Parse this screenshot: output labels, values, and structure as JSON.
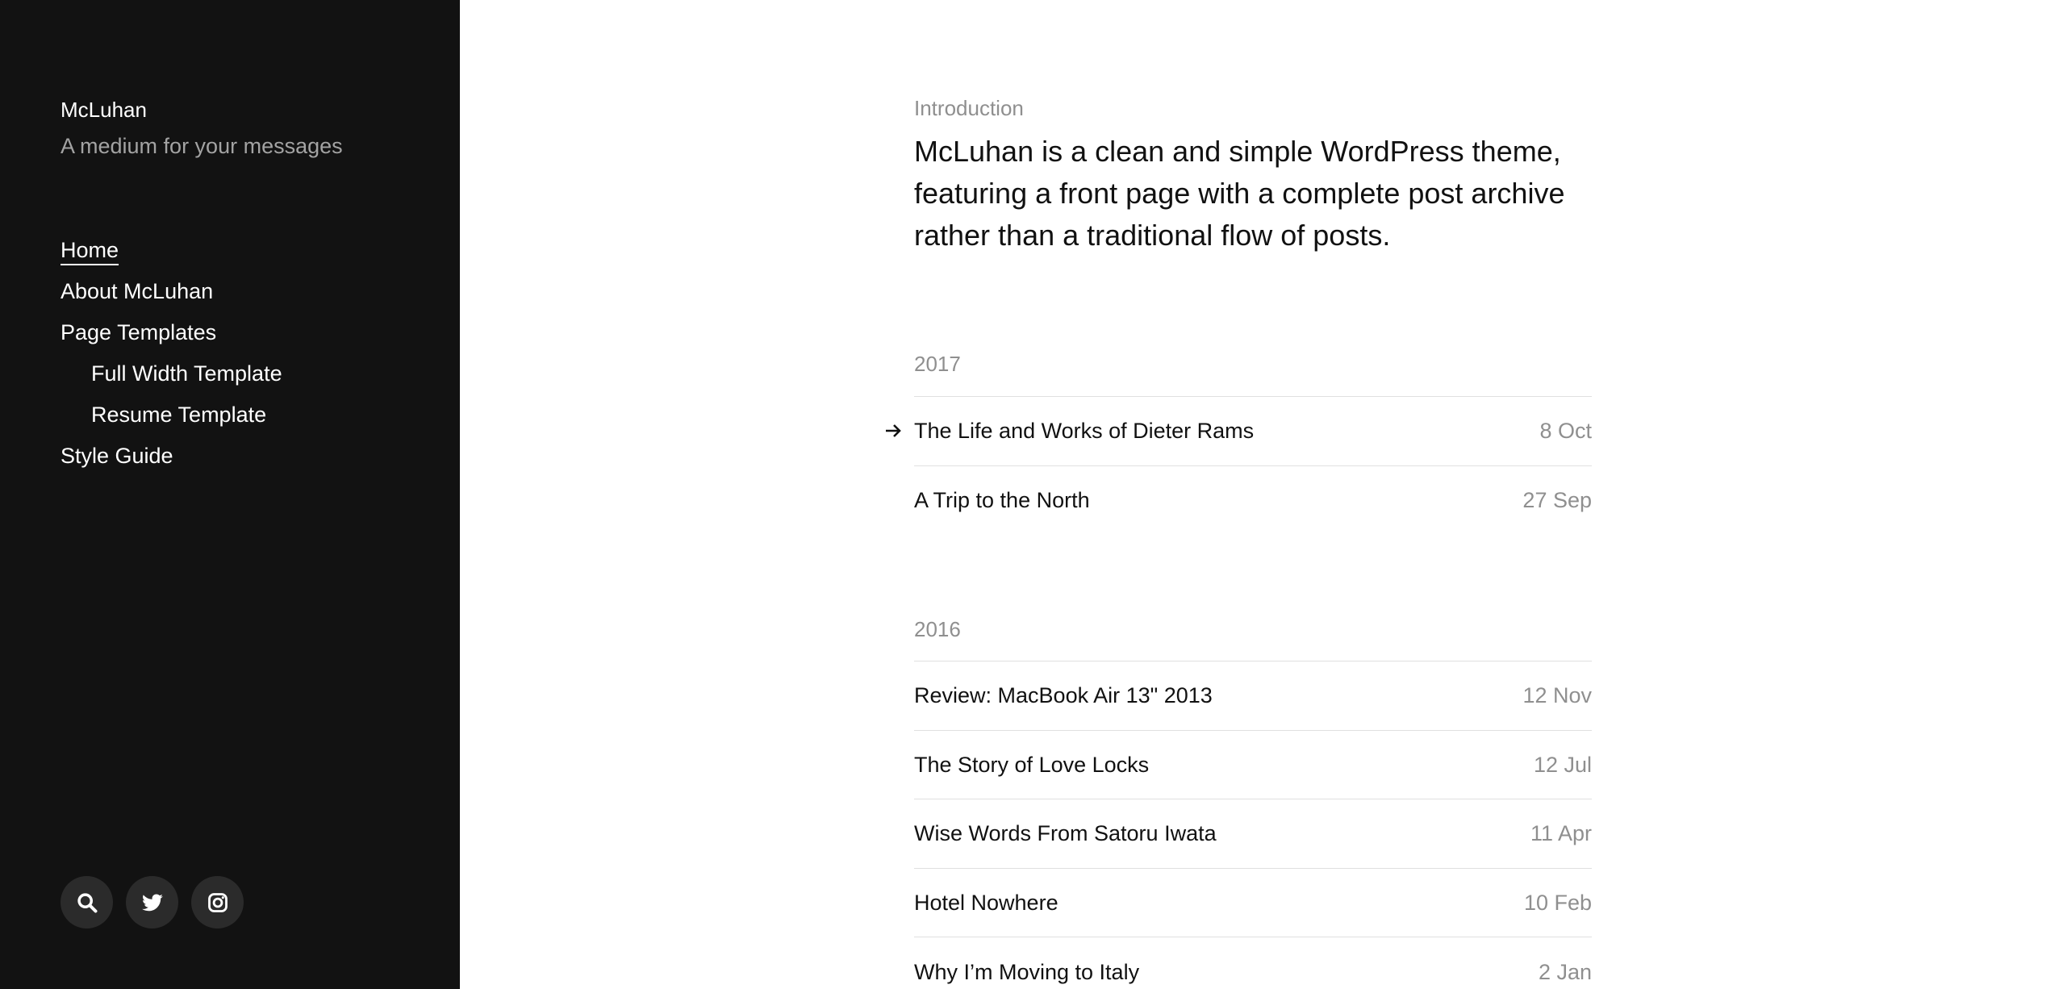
{
  "site": {
    "title": "McLuhan",
    "tagline": "A medium for your messages"
  },
  "nav": {
    "home": "Home",
    "about": "About McLuhan",
    "page_templates": "Page Templates",
    "full_width_template": "Full Width Template",
    "resume_template": "Resume Template",
    "style_guide": "Style Guide"
  },
  "social": [
    {
      "icon": "search-icon"
    },
    {
      "icon": "twitter-icon"
    },
    {
      "icon": "instagram-icon"
    }
  ],
  "intro": {
    "label": "Introduction",
    "text": "McLuhan is a clean and simple WordPress theme, featuring a front page with a complete post archive rather than a traditional flow of posts."
  },
  "archive": [
    {
      "year": "2017",
      "posts": [
        {
          "title": "The Life and Works of Dieter Rams",
          "date": "8 Oct"
        },
        {
          "title": "A Trip to the North",
          "date": "27 Sep"
        }
      ]
    },
    {
      "year": "2016",
      "posts": [
        {
          "title": "Review: MacBook Air 13\" 2013",
          "date": "12 Nov"
        },
        {
          "title": "The Story of Love Locks",
          "date": "12 Jul"
        },
        {
          "title": "Wise Words From Satoru Iwata",
          "date": "11 Apr"
        },
        {
          "title": "Hotel Nowhere",
          "date": "10 Feb"
        },
        {
          "title": "Why I’m Moving to Italy",
          "date": "2 Jan"
        }
      ]
    }
  ],
  "colors": {
    "sidebar_bg": "#121212",
    "muted_text": "#8f8f8f",
    "body_text": "#111111",
    "divider": "#e0e0e0"
  }
}
